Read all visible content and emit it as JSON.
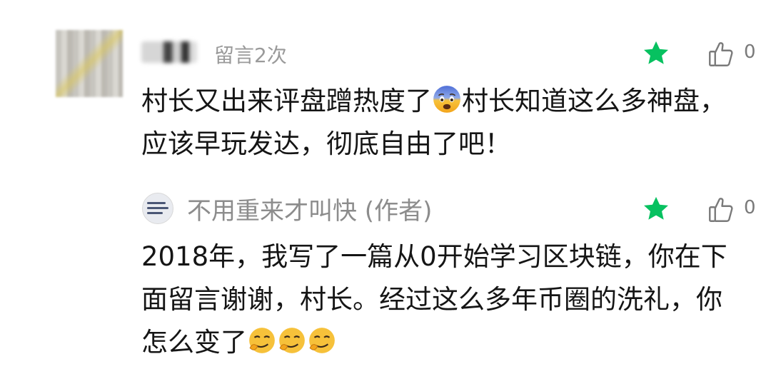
{
  "comment": {
    "author_blurred": true,
    "meta_text": "留言2次",
    "text": "村长又出来评盘蹭热度了",
    "emoji": "fearful-face",
    "text_after_emoji": "村长知道这么多神盘，应该早玩发达，彻底自由了吧！",
    "like_count": "0",
    "star_color": "#07c160"
  },
  "reply": {
    "author": "不用重来才叫快 (作者)",
    "text": "2018年，我写了一篇从0开始学习区块链，你在下面留言谢谢，村长。经过这么多年币圈的洗礼，你怎么变了",
    "emojis": [
      "smirk-face",
      "smirk-face",
      "smirk-face"
    ],
    "like_count": "0",
    "star_color": "#07c160"
  }
}
